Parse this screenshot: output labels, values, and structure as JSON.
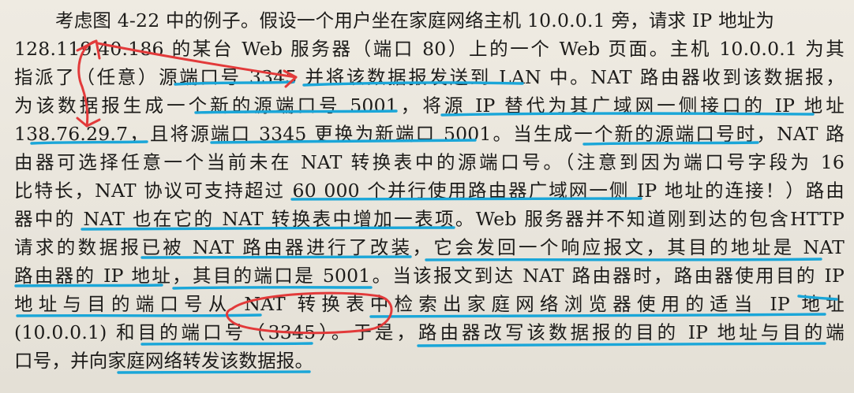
{
  "document": {
    "lines": [
      "考虑图 4-22 中的例子。假设一个用户坐在家庭网络主机 10.0.0.1 旁，请求 IP 地址为",
      "128.119.40.186 的某台 Web 服务器（端口 80）上的一个 Web 页面。主机 10.0.0.1 为其",
      "指派了（任意）源端口号 3345 并将该数据报发送到 LAN 中。NAT 路由器收到该数据报，",
      "为该数据报生成一个新的源端口号 5001，将源 IP 替代为其广域网一侧接口的 IP 地址",
      "138.76.29.7，且将源端口 3345 更换为新端口 5001。当生成一个新的源端口号时，NAT 路",
      "由器可选择任意一个当前未在 NAT 转换表中的源端口号。（注意到因为端口号字段为 16",
      "比特长，NAT 协议可支持超过 60 000 个并行使用路由器广域网一侧 IP 地址的连接！）路由",
      "器中的 NAT 也在它的 NAT 转换表中增加一表项。Web 服务器并不知道刚到达的包含HTTP",
      "请求的数据报已被 NAT 路由器进行了改装，它会发回一个响应报文，其目的地址是 NAT",
      "路由器的 IP 地址，其目的端口是 5001。当该报文到达 NAT 路由器时，路由器使用目的 IP",
      "地址与目的端口号从 NAT 转换表中检索出家庭网络浏览器使用的适当 IP 地址",
      "(10.0.0.1) 和目的端口号（3345）。于是，路由器改写该数据报的目的 IP 地址与目的端",
      "口号，并向家庭网络转发该数据报。"
    ]
  },
  "annotations": {
    "underline_color": "#1aa6d8",
    "marker_color": "#e23a3a"
  }
}
